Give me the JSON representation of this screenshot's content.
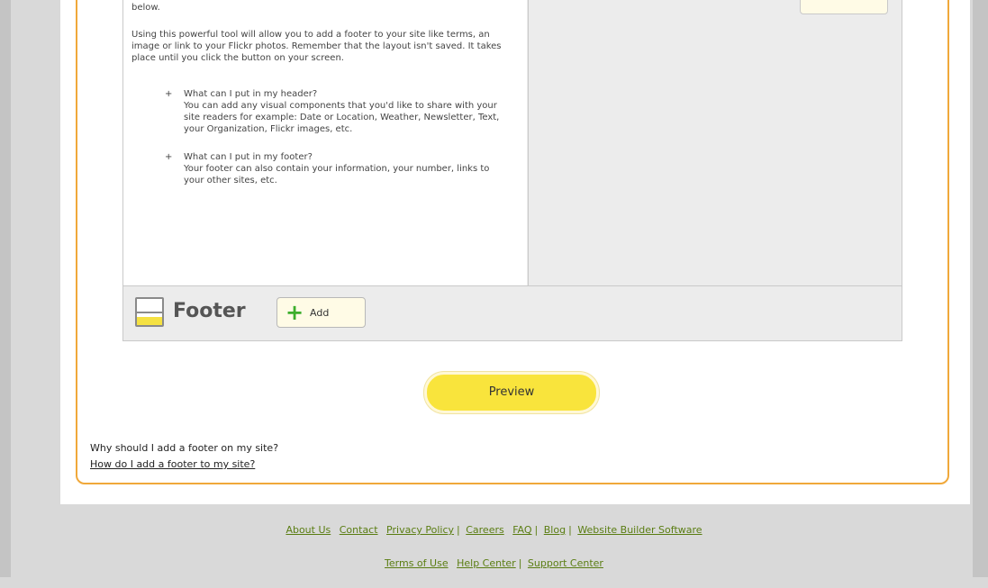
{
  "content": {
    "top_fragment": "below.",
    "intro": "Using this powerful tool will allow you to add a footer to your site like terms, an image or link to your Flickr photos. Remember that the layout isn't saved. It takes place until you click the button on your screen.",
    "bullets": [
      {
        "question": "What can I put in my header?",
        "answer": "You can add any visual components that you'd like to share with your site readers for example: Date or Location, Weather, Newsletter, Text, your Organization, Flickr images, etc."
      },
      {
        "question": "What can I put in my footer?",
        "answer": "Your footer can also contain your information, your number, links to your other sites, etc."
      }
    ]
  },
  "footer_section": {
    "label": "Footer",
    "add_button_label": "Add"
  },
  "preview_button_label": "Preview",
  "help": {
    "question": "Why should I add a footer on my site?",
    "link": "How do I add a footer to my site?"
  },
  "site_footer": {
    "row1": [
      "About Us",
      "Contact",
      "Privacy Policy",
      "Careers",
      "FAQ",
      "Blog",
      "Website Builder Software"
    ],
    "row2": [
      "Terms of Use",
      "Help Center",
      "Support Center"
    ]
  },
  "colors": {
    "accent_orange": "#f0a83a",
    "preview_yellow": "#f9e43c",
    "link_green": "#5a7d12",
    "add_plus_green": "#3cae2c"
  }
}
